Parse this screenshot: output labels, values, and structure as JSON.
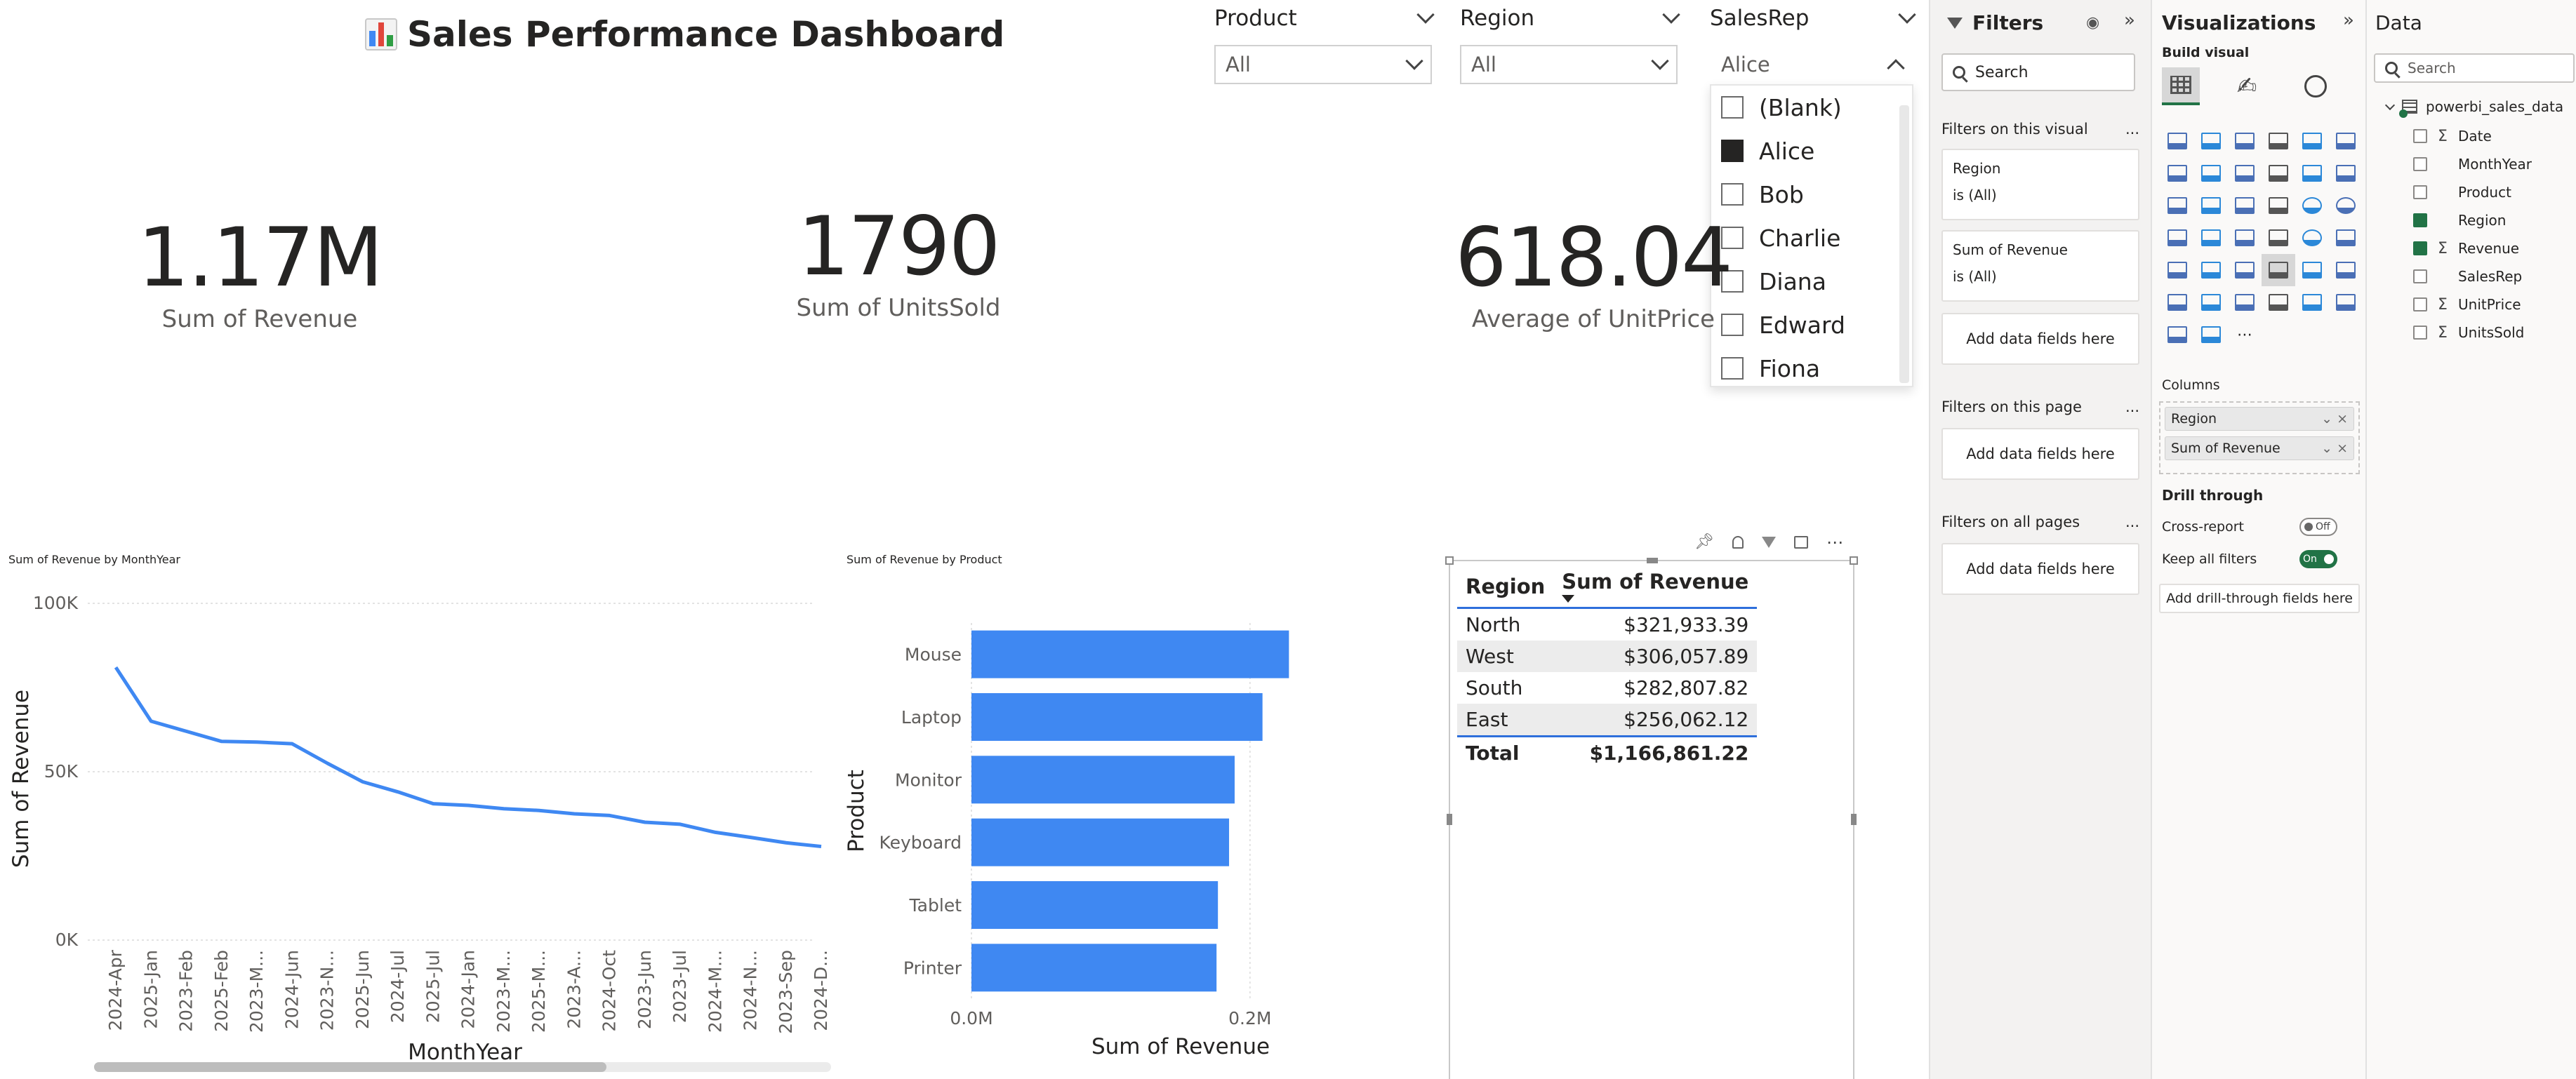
{
  "report": {
    "title": "Sales Performance Dashboard",
    "icon": "bar-chart-icon"
  },
  "slicers": {
    "product": {
      "label": "Product",
      "value": "All"
    },
    "region": {
      "label": "Region",
      "value": "All"
    },
    "salesrep": {
      "label": "SalesRep",
      "value": "Alice",
      "options": [
        {
          "label": "(Blank)",
          "checked": false
        },
        {
          "label": "Alice",
          "checked": true
        },
        {
          "label": "Bob",
          "checked": false
        },
        {
          "label": "Charlie",
          "checked": false
        },
        {
          "label": "Diana",
          "checked": false
        },
        {
          "label": "Edward",
          "checked": false
        },
        {
          "label": "Fiona",
          "checked": false
        }
      ]
    }
  },
  "cards": [
    {
      "value": "1.17M",
      "label": "Sum of Revenue"
    },
    {
      "value": "1790",
      "label": "Sum of UnitsSold"
    },
    {
      "value": "618.04",
      "label": "Average of UnitPrice"
    }
  ],
  "line_visual": {
    "title": "Sum of Revenue by MonthYear",
    "xlabel": "MonthYear",
    "ylabel": "Sum of Revenue",
    "y_ticks": [
      "100K",
      "50K",
      "0K"
    ]
  },
  "bar_visual": {
    "title": "Sum of Revenue by Product",
    "xlabel": "Sum of Revenue",
    "ylabel": "Product",
    "x_ticks": [
      "0.0M",
      "0.2M"
    ]
  },
  "table_visual": {
    "headers": [
      "Region",
      "Sum of Revenue"
    ],
    "rows": [
      [
        "North",
        "$321,933.39"
      ],
      [
        "West",
        "$306,057.89"
      ],
      [
        "South",
        "$282,807.82"
      ],
      [
        "East",
        "$256,062.12"
      ]
    ],
    "total": [
      "Total",
      "$1,166,861.22"
    ]
  },
  "chart_data": [
    {
      "type": "line",
      "title": "Sum of Revenue by MonthYear",
      "xlabel": "MonthYear",
      "ylabel": "Sum of Revenue",
      "x": [
        "2024-Apr",
        "2025-Jan",
        "2023-Feb",
        "2025-Feb",
        "2023-M...",
        "2024-Jun",
        "2023-N...",
        "2025-Jun",
        "2024-Jul",
        "2025-Jul",
        "2024-Jan",
        "2023-M...",
        "2025-M...",
        "2023-A...",
        "2024-Oct",
        "2023-Jun",
        "2023-Jul",
        "2024-M...",
        "2024-N...",
        "2023-Sep",
        "2024-D..."
      ],
      "values": [
        81000,
        65000,
        62000,
        59000,
        58800,
        58300,
        52500,
        47000,
        44000,
        40500,
        40000,
        39000,
        38500,
        37500,
        37000,
        35000,
        34400,
        32000,
        30500,
        28900,
        27800
      ],
      "ylim": [
        0,
        100000
      ],
      "color": "#3f88f2"
    },
    {
      "type": "bar",
      "orientation": "horizontal",
      "title": "Sum of Revenue by Product",
      "xlabel": "Sum of Revenue",
      "ylabel": "Product",
      "categories": [
        "Mouse",
        "Laptop",
        "Monitor",
        "Keyboard",
        "Tablet",
        "Printer"
      ],
      "values": [
        228000,
        209000,
        189000,
        185000,
        177000,
        176000
      ],
      "xlim": [
        0,
        250000
      ],
      "color": "#3f88f2"
    },
    {
      "type": "table",
      "columns": [
        "Region",
        "Sum of Revenue"
      ],
      "rows": [
        [
          "North",
          321933.39
        ],
        [
          "West",
          306057.89
        ],
        [
          "South",
          282807.82
        ],
        [
          "East",
          256062.12
        ]
      ],
      "total": 1166861.22
    }
  ],
  "visual_header_icons": [
    "pin-icon",
    "bell-icon",
    "filter-icon",
    "focus-mode-icon",
    "more-options-icon"
  ],
  "filters_pane": {
    "title": "Filters",
    "search_placeholder": "Search",
    "on_visual_label": "Filters on this visual",
    "visual_filters": [
      {
        "field": "Region",
        "state": "is (All)"
      },
      {
        "field": "Sum of Revenue",
        "state": "is (All)"
      }
    ],
    "add_fields": "Add data fields here",
    "on_page_label": "Filters on this page",
    "on_all_pages_label": "Filters on all pages",
    "more": "..."
  },
  "viz_pane": {
    "title": "Visualizations",
    "build_label": "Build visual",
    "columns_label": "Columns",
    "column_wells": [
      "Region",
      "Sum of Revenue"
    ],
    "drill_label": "Drill through",
    "cross_report_label": "Cross-report",
    "cross_report_state": "Off",
    "keep_filters_label": "Keep all filters",
    "keep_filters_state": "On",
    "add_drill": "Add drill-through fields here",
    "more_icons": "..."
  },
  "data_pane": {
    "title": "Data",
    "search_placeholder": "Search",
    "table_name": "powerbi_sales_data",
    "fields": [
      {
        "name": "Date",
        "checked": false,
        "sigma": true
      },
      {
        "name": "MonthYear",
        "checked": false,
        "sigma": false
      },
      {
        "name": "Product",
        "checked": false,
        "sigma": false
      },
      {
        "name": "Region",
        "checked": true,
        "sigma": false
      },
      {
        "name": "Revenue",
        "checked": true,
        "sigma": true
      },
      {
        "name": "SalesRep",
        "checked": false,
        "sigma": false
      },
      {
        "name": "UnitPrice",
        "checked": false,
        "sigma": true
      },
      {
        "name": "UnitsSold",
        "checked": false,
        "sigma": true
      }
    ]
  },
  "colors": {
    "accent": "#3f88f2",
    "table_rule": "#2e6fdb",
    "toggle_on": "#217346",
    "checked_field": "#217346"
  }
}
